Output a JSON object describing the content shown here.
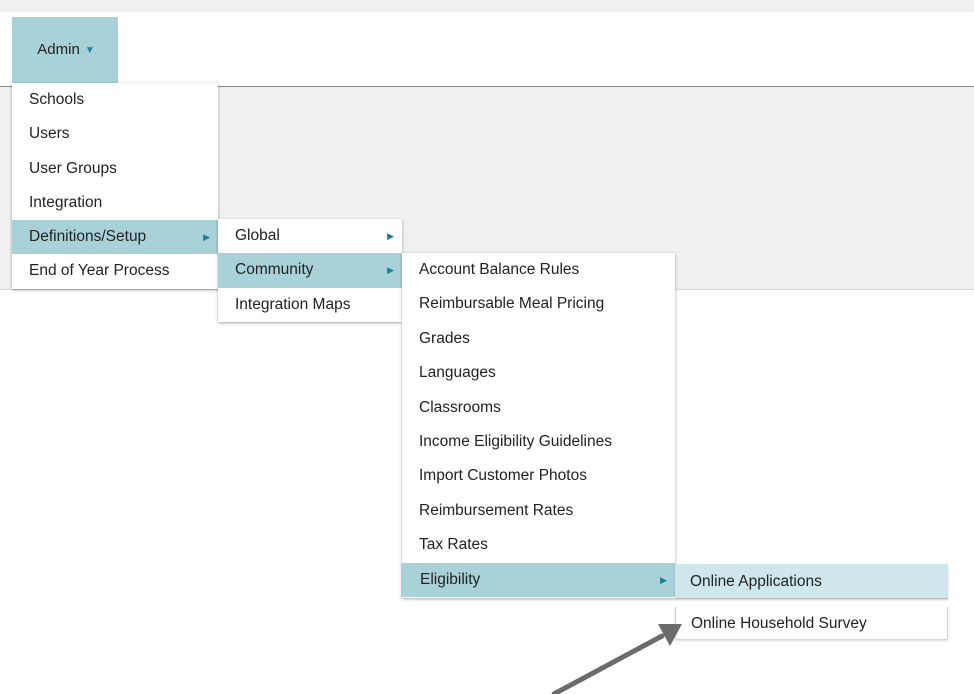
{
  "nav": {
    "admin_label": "Admin",
    "admin_caret": "▼"
  },
  "menus": {
    "level1": [
      {
        "label": "Schools"
      },
      {
        "label": "Users"
      },
      {
        "label": "User Groups"
      },
      {
        "label": "Integration"
      },
      {
        "label": "Definitions/Setup",
        "submenu": true,
        "active": true
      },
      {
        "label": "End of Year Process"
      }
    ],
    "level2": [
      {
        "label": "Global",
        "submenu": true
      },
      {
        "label": "Community",
        "submenu": true,
        "active": true
      },
      {
        "label": "Integration Maps"
      }
    ],
    "level3": [
      {
        "label": "Account Balance Rules"
      },
      {
        "label": "Reimbursable Meal Pricing"
      },
      {
        "label": "Grades"
      },
      {
        "label": "Languages"
      },
      {
        "label": "Classrooms"
      },
      {
        "label": "Income Eligibility Guidelines"
      },
      {
        "label": "Import Customer Photos"
      },
      {
        "label": "Reimbursement Rates"
      },
      {
        "label": "Tax Rates"
      },
      {
        "label": "Eligibility",
        "submenu": true,
        "active": true
      }
    ],
    "level4": [
      {
        "label": "Online Applications",
        "hover": true
      },
      {
        "label": "Online Household Survey"
      }
    ]
  },
  "submenu_arrow": "▶",
  "colors": {
    "active": "#a9d2d8",
    "hover": "#cfe6ea",
    "accent": "#1a7f96",
    "annotation_arrow": "#6b6b6b"
  }
}
